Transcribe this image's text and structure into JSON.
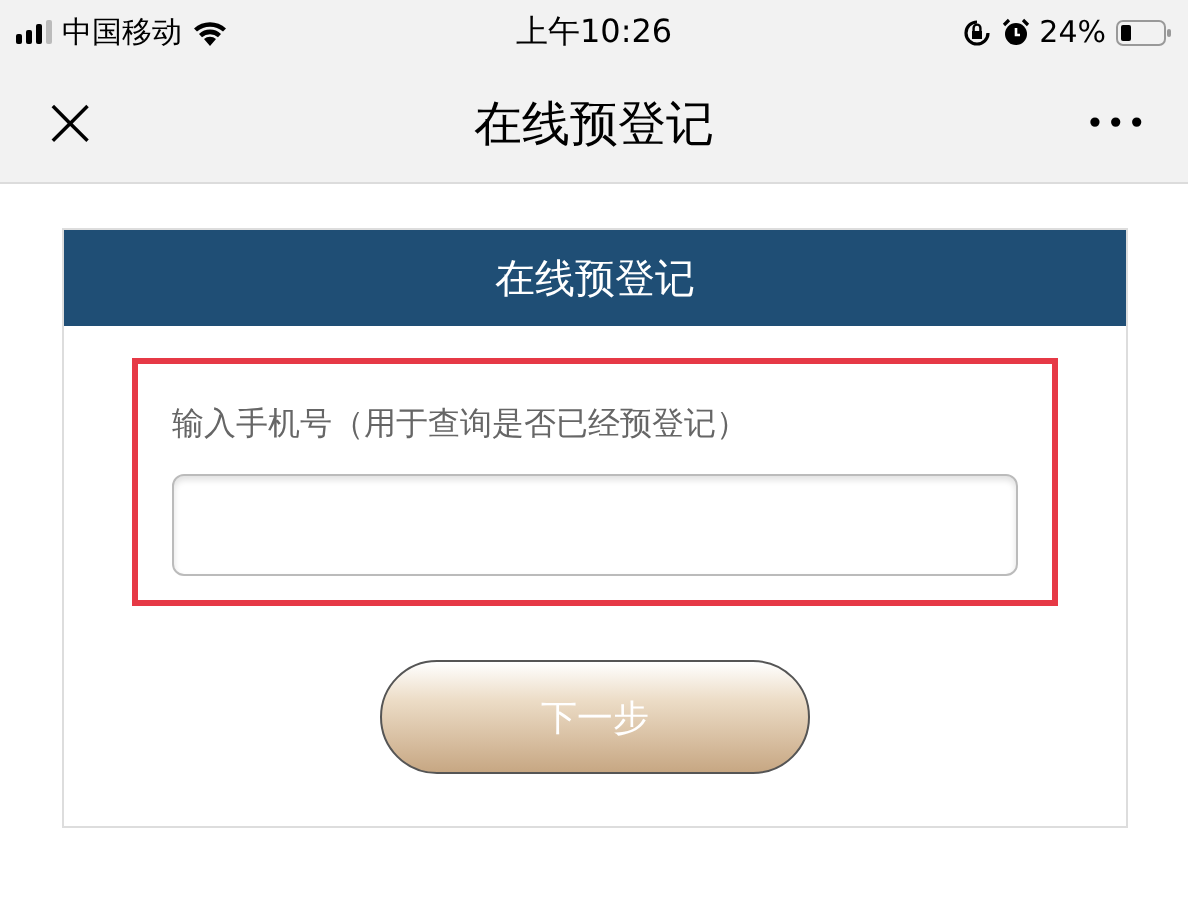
{
  "status_bar": {
    "carrier": "中国移动",
    "time": "上午10:26",
    "battery": "24%"
  },
  "nav_bar": {
    "close": "×",
    "title": "在线预登记",
    "more": "•••"
  },
  "card": {
    "title": "在线预登记",
    "field_label": "输入手机号（用于查询是否已经预登记）",
    "next_button": "下一步"
  }
}
